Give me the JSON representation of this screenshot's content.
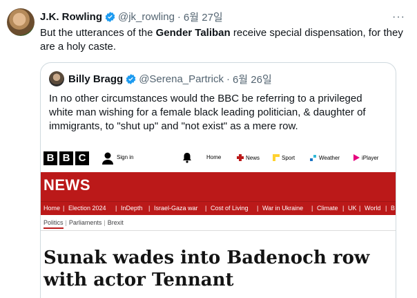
{
  "tweet": {
    "author": "J.K. Rowling",
    "handle": "@jk_rowling",
    "separator": "·",
    "date": "6월 27일",
    "text_part1": "But the utterances of the ",
    "text_bold": "Gender Taliban",
    "text_part2": " receive special dispensation, for they are a holy caste.",
    "more_label": "···"
  },
  "quote": {
    "author": "Billy Bragg",
    "handle": "@Serena_Partrick",
    "separator": "·",
    "date": "6월 26일",
    "text": "In no other circumstances would the BBC be referring to a privileged white man wishing for a female black leading politician, & daughter of immigrants, to \"shut up\" and \"not exist\" as a mere row."
  },
  "bbc": {
    "logo_letters": [
      "B",
      "B",
      "C"
    ],
    "signin_label": "Sign in",
    "nav": [
      {
        "label": "Home",
        "icon": "home-icon"
      },
      {
        "label": "News",
        "icon": "news-icon"
      },
      {
        "label": "Sport",
        "icon": "sport-icon"
      },
      {
        "label": "Weather",
        "icon": "weather-icon"
      },
      {
        "label": "iPlayer",
        "icon": "iplayer-icon"
      }
    ],
    "news_title": "NEWS",
    "subnav": [
      "Home",
      "|",
      "Election 2024",
      "|",
      "InDepth",
      "|",
      "Israel-Gaza war",
      "|",
      "Cost of Living",
      "|",
      "War in Ukraine",
      "|",
      "Climate",
      "|",
      "UK",
      "|",
      "World",
      "|",
      "B"
    ],
    "crumbs": [
      "Politics",
      "|",
      "Parliaments",
      "|",
      "Brexit"
    ],
    "headline": "Sunak wades into Badenoch row with actor Tennant",
    "colors": {
      "bbc_red": "#bb1919",
      "verified_blue": "#1d9bf0"
    }
  }
}
